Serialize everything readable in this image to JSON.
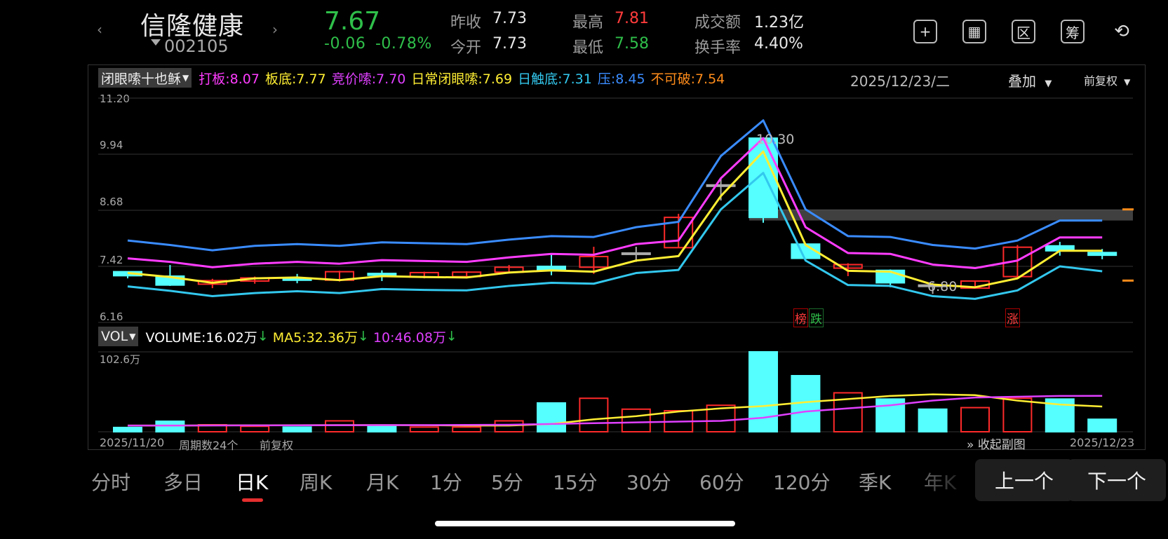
{
  "header": {
    "stock_name": "信隆健康",
    "stock_code": "002105",
    "price": "7.67",
    "change": "-0.06",
    "change_pct": "-0.78%",
    "quotes": [
      {
        "label": "昨收",
        "value": "7.73"
      },
      {
        "label": "今开",
        "value": "7.73"
      },
      {
        "label": "最高",
        "value": "7.81"
      },
      {
        "label": "最低",
        "value": "7.58"
      },
      {
        "label": "成交额",
        "value": "1.23亿"
      },
      {
        "label": "换手率",
        "value": "4.40%"
      }
    ],
    "toolbar_icons": [
      "plus-box-icon",
      "screen-icon",
      "region-icon",
      "chip-icon",
      "rotate-icon"
    ],
    "toolbar_glyphs": [
      "+",
      "▦",
      "区",
      "筹",
      "⟲"
    ]
  },
  "indicator": {
    "selected": "闭眼嗦十也稣",
    "items": [
      {
        "label": "打板:8.07",
        "color": "#ff3cff"
      },
      {
        "label": "板底:7.77",
        "color": "#ffee33"
      },
      {
        "label": "竞价嗦:7.70",
        "color": "#e040ff"
      },
      {
        "label": "日常闭眼嗦:7.69",
        "color": "#ffee33"
      },
      {
        "label": "日触底:7.31",
        "color": "#33c8ee"
      },
      {
        "label": "压:8.45",
        "color": "#3a8cff"
      },
      {
        "label": "不可破:7.54",
        "color": "#ff8c1a"
      }
    ],
    "date": "2025/12/23/二",
    "overlay_label": "叠加",
    "fuquan_label": "前复权"
  },
  "main_chart": {
    "y_labels": [
      "11.20",
      "9.94",
      "8.68",
      "7.42",
      "6.16"
    ],
    "high_label": "10.30",
    "low_label": "6.80",
    "tags": [
      "榜",
      "跌",
      "涨"
    ]
  },
  "volume": {
    "selected": "VOL",
    "volume_label": "VOLUME:16.02万",
    "ma5_label": "MA5:32.36万",
    "ma10_label": "10:46.08万",
    "max_label": "102.6万"
  },
  "footer": {
    "start_date": "2025/11/20",
    "period_count": "周期数24个",
    "fuquan": "前复权",
    "collapse": "收起副图",
    "end_date": "2025/12/23"
  },
  "tabs": [
    "分时",
    "多日",
    "日K",
    "周K",
    "月K",
    "1分",
    "5分",
    "15分",
    "30分",
    "60分",
    "120分",
    "季K",
    "年K"
  ],
  "active_tab": "日K",
  "buttons": {
    "prev": "上一个",
    "next": "下一个"
  },
  "colors": {
    "up": "#ff2a2a",
    "down": "#55ffff",
    "accent": "#e52e2e"
  },
  "chart_data": [
    {
      "type": "candlestick",
      "y_axis_ticks": [
        11.2,
        9.94,
        8.68,
        7.42,
        6.16
      ],
      "ylim": [
        6.16,
        11.2
      ],
      "candles": [
        {
          "o": 7.3,
          "c": 7.21,
          "h": 7.31,
          "l": 7.15
        },
        {
          "o": 7.2,
          "c": 7.0,
          "h": 7.45,
          "l": 6.98
        },
        {
          "o": 7.02,
          "c": 7.1,
          "h": 7.14,
          "l": 6.93
        },
        {
          "o": 7.09,
          "c": 7.16,
          "h": 7.19,
          "l": 7.03
        },
        {
          "o": 7.14,
          "c": 7.12,
          "h": 7.25,
          "l": 7.04
        },
        {
          "o": 7.11,
          "c": 7.3,
          "h": 7.32,
          "l": 7.08
        },
        {
          "o": 7.26,
          "c": 7.22,
          "h": 7.33,
          "l": 7.09
        },
        {
          "o": 7.18,
          "c": 7.28,
          "h": 7.3,
          "l": 7.15
        },
        {
          "o": 7.19,
          "c": 7.29,
          "h": 7.31,
          "l": 7.15
        },
        {
          "o": 7.29,
          "c": 7.4,
          "h": 7.45,
          "l": 7.27
        },
        {
          "o": 7.42,
          "c": 7.32,
          "h": 7.7,
          "l": 7.22
        },
        {
          "o": 7.4,
          "c": 7.64,
          "h": 7.86,
          "l": 7.25
        },
        {
          "o": 7.72,
          "c": 7.72,
          "h": 7.86,
          "l": 7.52
        },
        {
          "o": 7.84,
          "c": 8.52,
          "h": 8.6,
          "l": 7.84
        },
        {
          "o": 9.25,
          "c": 9.25,
          "h": 9.4,
          "l": 8.9
        },
        {
          "o": 10.3,
          "c": 8.52,
          "h": 10.3,
          "l": 8.4
        },
        {
          "o": 7.92,
          "c": 7.6,
          "h": 7.93,
          "l": 7.58
        },
        {
          "o": 7.38,
          "c": 7.46,
          "h": 7.49,
          "l": 7.2
        },
        {
          "o": 7.33,
          "c": 7.05,
          "h": 7.35,
          "l": 6.95
        },
        {
          "o": 7.0,
          "c": 7.0,
          "h": 7.05,
          "l": 6.8
        },
        {
          "o": 6.93,
          "c": 7.09,
          "h": 7.1,
          "l": 6.92
        },
        {
          "o": 7.19,
          "c": 7.85,
          "h": 7.9,
          "l": 7.18
        },
        {
          "o": 7.88,
          "c": 7.77,
          "h": 7.97,
          "l": 7.66
        },
        {
          "o": 7.73,
          "c": 7.67,
          "h": 7.81,
          "l": 7.58
        }
      ],
      "lines": [
        {
          "name": "压",
          "color": "#3a8cff",
          "values": [
            8.0,
            7.9,
            7.78,
            7.88,
            7.92,
            7.88,
            7.96,
            7.94,
            7.92,
            8.02,
            8.1,
            8.08,
            8.3,
            8.42,
            9.9,
            10.7,
            8.7,
            8.1,
            8.08,
            7.9,
            7.82,
            8.0,
            8.45,
            8.45
          ]
        },
        {
          "name": "打板",
          "color": "#ff3cff",
          "values": [
            7.6,
            7.52,
            7.4,
            7.48,
            7.52,
            7.48,
            7.56,
            7.54,
            7.52,
            7.62,
            7.7,
            7.68,
            7.92,
            8.0,
            9.4,
            10.3,
            8.3,
            7.72,
            7.7,
            7.46,
            7.38,
            7.55,
            8.07,
            8.07
          ]
        },
        {
          "name": "板底",
          "color": "#ffee33",
          "values": [
            7.27,
            7.18,
            7.05,
            7.15,
            7.17,
            7.11,
            7.2,
            7.18,
            7.17,
            7.28,
            7.33,
            7.3,
            7.55,
            7.65,
            9.0,
            10.0,
            7.9,
            7.32,
            7.3,
            7.01,
            6.95,
            7.15,
            7.77,
            7.77
          ]
        },
        {
          "name": "日触底",
          "color": "#33c8ee",
          "values": [
            6.97,
            6.87,
            6.75,
            6.82,
            6.86,
            6.82,
            6.91,
            6.89,
            6.88,
            6.98,
            7.05,
            7.03,
            7.27,
            7.34,
            8.7,
            9.52,
            7.55,
            7.0,
            6.98,
            6.75,
            6.69,
            6.88,
            7.42,
            7.31
          ]
        }
      ],
      "resistance_zone": [
        8.45,
        8.7
      ]
    },
    {
      "type": "bar",
      "title": "VOL",
      "ylim": [
        0,
        102.6
      ],
      "values": [
        5.5,
        13.5,
        9,
        7,
        6,
        14,
        8,
        6,
        6,
        14,
        37,
        43,
        29,
        27,
        34,
        102.6,
        72,
        50,
        42,
        29,
        31,
        43,
        42,
        16.02
      ],
      "up": [
        false,
        false,
        true,
        true,
        false,
        true,
        false,
        true,
        true,
        true,
        false,
        true,
        true,
        true,
        true,
        false,
        false,
        true,
        false,
        false,
        true,
        true,
        false,
        false
      ],
      "ma5": [
        8,
        8,
        8.2,
        8.3,
        8.4,
        8.6,
        8.6,
        8.4,
        8,
        8,
        10,
        16,
        20,
        26,
        30,
        33,
        38,
        42,
        46,
        48,
        47,
        40,
        35,
        32.36
      ],
      "ma10": [
        8,
        8,
        8.1,
        8.2,
        8.3,
        8.4,
        8.5,
        8.6,
        8.8,
        9,
        10,
        11,
        12,
        13,
        14,
        18,
        26,
        30,
        34,
        40,
        44,
        45,
        46,
        46.08
      ]
    }
  ]
}
